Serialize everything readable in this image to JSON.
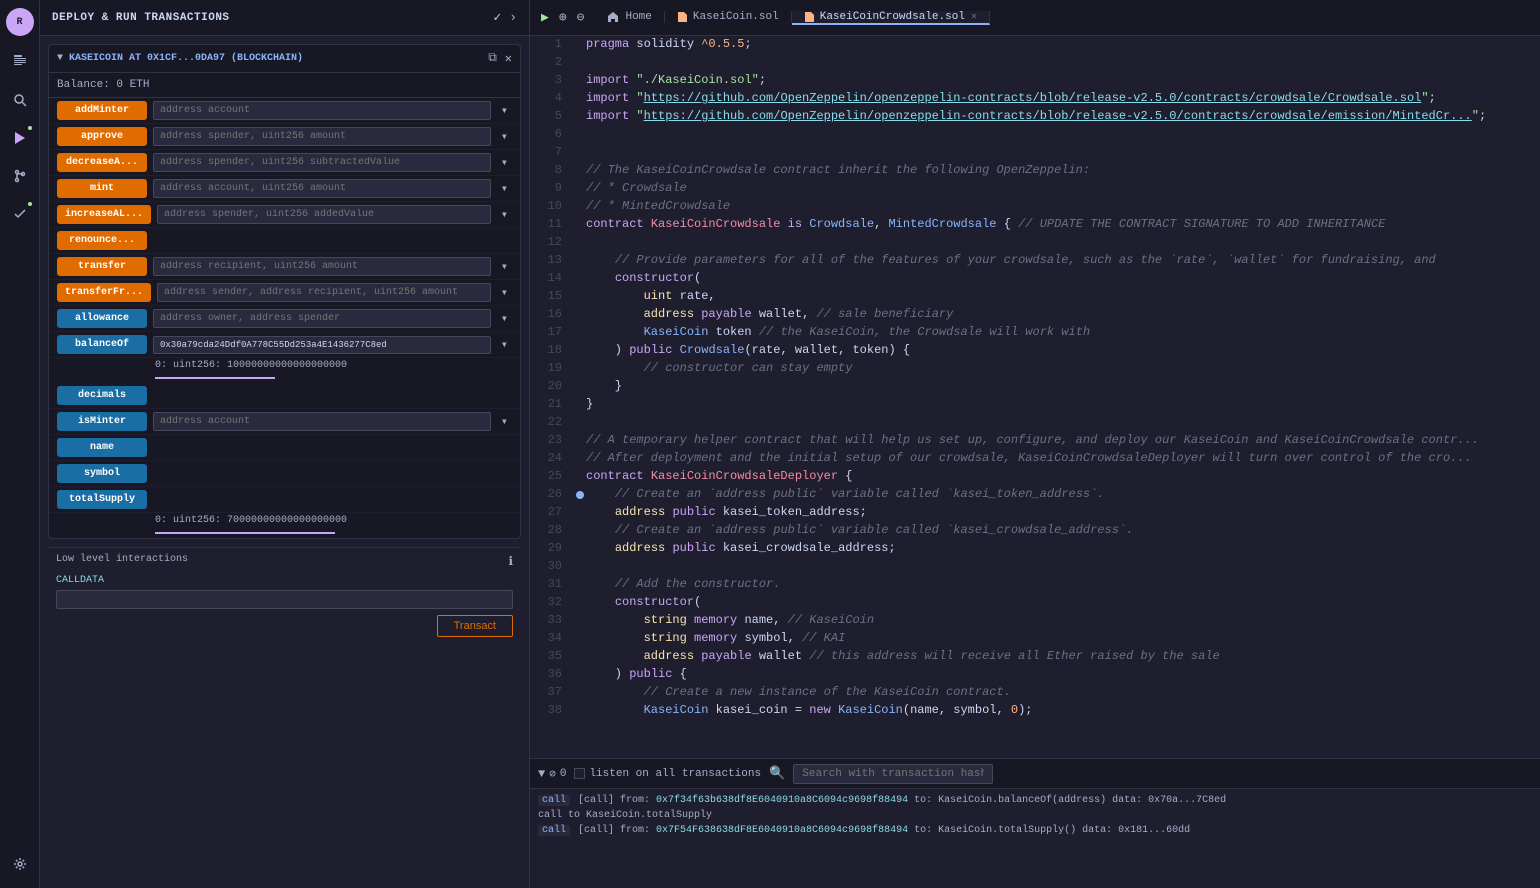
{
  "sidebar": {
    "logo": "R",
    "icons": [
      {
        "name": "files-icon",
        "symbol": "⊞",
        "active": false
      },
      {
        "name": "search-icon",
        "symbol": "🔍",
        "active": false
      },
      {
        "name": "deploy-icon",
        "symbol": "✦",
        "active": true
      },
      {
        "name": "git-icon",
        "symbol": "⎇",
        "active": false
      },
      {
        "name": "check-icon",
        "symbol": "✓",
        "active": false
      },
      {
        "name": "settings-icon",
        "symbol": "⚙",
        "active": false
      }
    ]
  },
  "deploy_panel": {
    "title": "DEPLOY & RUN TRANSACTIONS",
    "contract_section": {
      "title": "KASEICOIN AT 0X1CF...0DA97 (BLOCKCHAIN)",
      "balance": "Balance: 0 ETH",
      "functions": [
        {
          "name": "addMinter",
          "style": "orange",
          "placeholder": "address account",
          "has_input": true
        },
        {
          "name": "approve",
          "style": "orange",
          "placeholder": "address spender, uint256 amount",
          "has_input": true
        },
        {
          "name": "decreaseA...",
          "style": "orange",
          "placeholder": "address spender, uint256 subtractedValue",
          "has_input": true
        },
        {
          "name": "mint",
          "style": "orange",
          "placeholder": "address account, uint256 amount",
          "has_input": true
        },
        {
          "name": "increaseAL...",
          "style": "orange",
          "placeholder": "address spender, uint256 addedValue",
          "has_input": true
        },
        {
          "name": "renounce...",
          "style": "orange",
          "placeholder": "",
          "has_input": false
        },
        {
          "name": "transfer",
          "style": "orange",
          "placeholder": "address recipient, uint256 amount",
          "has_input": true
        },
        {
          "name": "transferFr...",
          "style": "orange",
          "placeholder": "address sender, address recipient, uint256 amount",
          "has_input": true
        },
        {
          "name": "allowance",
          "style": "blue",
          "placeholder": "address owner, address spender",
          "has_input": true
        },
        {
          "name": "balanceOf",
          "style": "blue",
          "placeholder": "",
          "has_input": true,
          "value": "0x30a79cda24Ddf0A778C55Dd253a4E1436277C8ed",
          "result": "0: uint256: 10000000000000000000"
        },
        {
          "name": "decimals",
          "style": "blue",
          "placeholder": "",
          "has_input": false
        },
        {
          "name": "isMinter",
          "style": "blue",
          "placeholder": "address account",
          "has_input": true
        },
        {
          "name": "name",
          "style": "blue",
          "placeholder": "",
          "has_input": false
        },
        {
          "name": "symbol",
          "style": "blue",
          "placeholder": "",
          "has_input": false
        },
        {
          "name": "totalSupply",
          "style": "blue",
          "placeholder": "",
          "has_input": false,
          "result": "0: uint256: 70000000000000000000"
        }
      ]
    },
    "low_level": {
      "title": "Low level interactions",
      "calldata_label": "CALLDATA",
      "transact_btn": "Transact"
    }
  },
  "editor": {
    "toolbar": {
      "play_icon": "▶",
      "zoom_in": "⊕",
      "zoom_out": "⊖",
      "home_label": "Home",
      "tab1_label": "KaseiCoin.sol",
      "tab2_label": "KaseiCoinCrowdsale.sol"
    },
    "lines": [
      {
        "num": 1,
        "content": "pragma solidity ^0.5.5;",
        "dot": false
      },
      {
        "num": 2,
        "content": "",
        "dot": false
      },
      {
        "num": 3,
        "content": "import \"./KaseiCoin.sol\";",
        "dot": false
      },
      {
        "num": 4,
        "content": "import \"https://github.com/OpenZeppelin/openzeppelin-contracts/blob/release-v2.5.0/contracts/crowdsale/Crowdsale.sol\";",
        "dot": false
      },
      {
        "num": 5,
        "content": "import \"https://github.com/OpenZeppelin/openzeppelin-contracts/blob/release-v2.5.0/contracts/crowdsale/emission/MintedCr...",
        "dot": false
      },
      {
        "num": 6,
        "content": "",
        "dot": false
      },
      {
        "num": 7,
        "content": "",
        "dot": false
      },
      {
        "num": 8,
        "content": "// The KaseiCoinCrowdsale contract inherit the following OpenZeppelin:",
        "dot": false
      },
      {
        "num": 9,
        "content": "// * Crowdsale",
        "dot": false
      },
      {
        "num": 10,
        "content": "// * MintedCrowdsale",
        "dot": false
      },
      {
        "num": 11,
        "content": "contract KaseiCoinCrowdsale is Crowdsale, MintedCrowdsale { // UPDATE THE CONTRACT SIGNATURE TO ADD INHERITANCE",
        "dot": false
      },
      {
        "num": 12,
        "content": "",
        "dot": false
      },
      {
        "num": 13,
        "content": "    // Provide parameters for all of the features of your crowdsale, such as the `rate`, `wallet` for fundraising, and",
        "dot": false
      },
      {
        "num": 14,
        "content": "    constructor(",
        "dot": false
      },
      {
        "num": 15,
        "content": "        uint rate,",
        "dot": false
      },
      {
        "num": 16,
        "content": "        address payable wallet, // sale beneficiary",
        "dot": false
      },
      {
        "num": 17,
        "content": "        KaseiCoin token // the KaseiCoin, the Crowdsale will work with",
        "dot": false
      },
      {
        "num": 18,
        "content": "    ) public Crowdsale(rate, wallet, token) {",
        "dot": false
      },
      {
        "num": 19,
        "content": "        // constructor can stay empty",
        "dot": false
      },
      {
        "num": 20,
        "content": "    }",
        "dot": false
      },
      {
        "num": 21,
        "content": "}",
        "dot": false
      },
      {
        "num": 22,
        "content": "",
        "dot": false
      },
      {
        "num": 23,
        "content": "// A temporary helper contract that will help us set up, configure, and deploy our KaseiCoin and KaseiCoinCrowdsale contr...",
        "dot": false
      },
      {
        "num": 24,
        "content": "// After deployment and the initial setup of our crowdsale, KaseiCoinCrowdsaleDeployer will turn over control of the cro...",
        "dot": false
      },
      {
        "num": 25,
        "content": "contract KaseiCoinCrowdsaleDeployer {",
        "dot": false
      },
      {
        "num": 26,
        "content": "    // Create an `address public` variable called `kasei_token_address`.",
        "dot": true
      },
      {
        "num": 27,
        "content": "    address public kasei_token_address;",
        "dot": false
      },
      {
        "num": 28,
        "content": "    // Create an `address public` variable called `kasei_crowdsale_address`.",
        "dot": false
      },
      {
        "num": 29,
        "content": "    address public kasei_crowdsale_address;",
        "dot": false
      },
      {
        "num": 30,
        "content": "",
        "dot": false
      },
      {
        "num": 31,
        "content": "    // Add the constructor.",
        "dot": false
      },
      {
        "num": 32,
        "content": "    constructor(",
        "dot": false
      },
      {
        "num": 33,
        "content": "        string memory name, // KaseiCoin",
        "dot": false
      },
      {
        "num": 34,
        "content": "        string memory symbol, // KAI",
        "dot": false
      },
      {
        "num": 35,
        "content": "        address payable wallet // this address will receive all Ether raised by the sale",
        "dot": false
      },
      {
        "num": 36,
        "content": "    ) public {",
        "dot": false
      },
      {
        "num": 37,
        "content": "        // Create a new instance of the KaseiCoin contract.",
        "dot": false
      },
      {
        "num": 38,
        "content": "        KaseiCoin kasei_coin = new KaseiCoin(name, symbol, 0);",
        "dot": false
      }
    ]
  },
  "bottom_panel": {
    "count": "0",
    "listen_label": "listen on all transactions",
    "search_placeholder": "Search with transaction hash or address",
    "logs": [
      {
        "tag": "call",
        "text": "[call] from: 0x7f34f63b638df8E6040910a8C6094c9698f88494 to: KaseiCoin.balanceOf(address) data: 0x70a...7C8ed"
      },
      {
        "tag": "",
        "text": "call to KaseiCoin.totalSupply"
      },
      {
        "tag": "call",
        "text": "[call] from: 0x7F54F638638dF8E6040910a8C6094c9698f88494 to: KaseiCoin.totalSupply() data: 0x181...60dd"
      }
    ]
  }
}
